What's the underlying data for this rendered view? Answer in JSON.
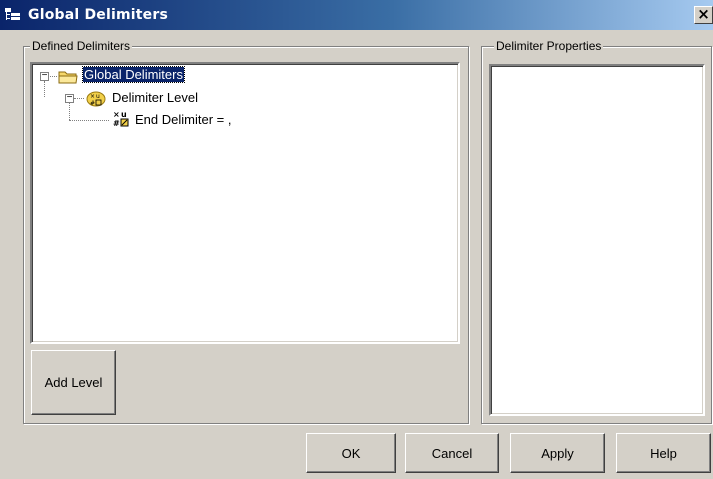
{
  "window": {
    "title": "Global Delimiters",
    "close_label": "×"
  },
  "defined_group": {
    "label": "Defined Delimiters",
    "tree": [
      {
        "label": "Global Delimiters",
        "icon": "folder-icon",
        "expanded": true,
        "selected": true
      },
      {
        "label": "Delimiter Level",
        "icon": "delimiter-level-icon",
        "expanded": true
      },
      {
        "label": "End Delimiter = ,",
        "icon": "delimiter-item-icon"
      }
    ],
    "add_level_label": "Add Level"
  },
  "properties_group": {
    "label": "Delimiter Properties"
  },
  "buttons": {
    "ok": "OK",
    "cancel": "Cancel",
    "apply": "Apply",
    "help": "Help"
  },
  "colors": {
    "title_bar_start": "#0a246a",
    "title_bar_end": "#a6caf0",
    "dialog_bg": "#d4d0c8",
    "selection": "#0a246a"
  }
}
